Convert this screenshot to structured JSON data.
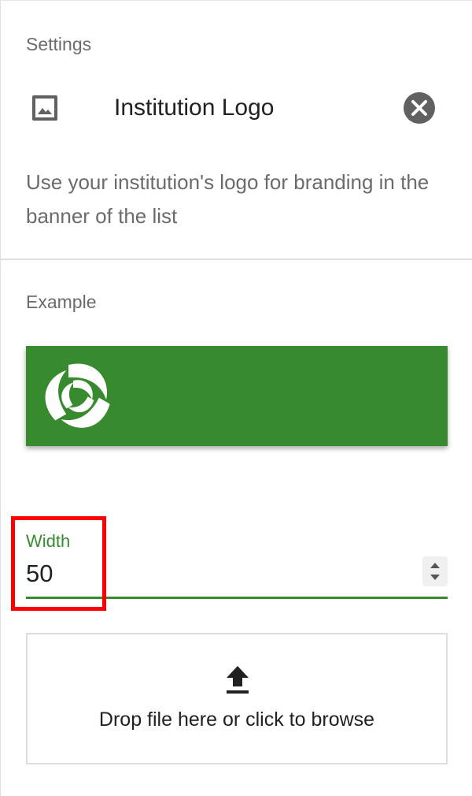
{
  "panel": {
    "section_title": "Settings",
    "setting": {
      "icon": "image-icon",
      "title": "Institution Logo",
      "close_icon": "close-circle-icon",
      "description": "Use your institution's logo for branding in the banner of the list"
    },
    "example": {
      "label": "Example",
      "banner_color": "#378a2e",
      "logo_icon": "swirl-logo-icon"
    },
    "width_field": {
      "label": "Width",
      "value": "50",
      "accent_color": "#378a2e",
      "stepper_icon": "stepper-arrows-icon",
      "highlight_color": "#ff0000"
    },
    "upload": {
      "icon": "upload-arrow-icon",
      "text": "Drop file here or click to browse"
    }
  }
}
